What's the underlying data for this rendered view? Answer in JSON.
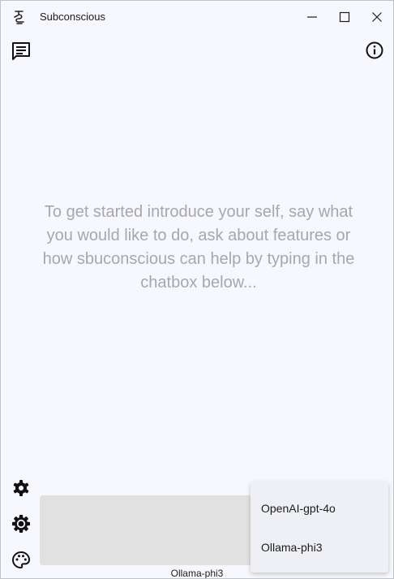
{
  "window": {
    "title": "Subconscious",
    "controls": [
      "minimize-icon",
      "maximize-icon",
      "close-icon"
    ]
  },
  "toolbar": {
    "left_icon": "chat-icon",
    "right_icon": "info-icon"
  },
  "main": {
    "intro_text": "To get started introduce your self, say what you would like to do, ask about features or how sbuconscious can help by typing in the chatbox below..."
  },
  "sidebar": {
    "icons": [
      "settings-gear-icon",
      "brightness-gear-icon",
      "palette-icon"
    ]
  },
  "chat": {
    "input_value": "",
    "selected_model": "Ollama-phi3"
  },
  "model_menu": {
    "items": [
      {
        "label": "OpenAI-gpt-4o"
      },
      {
        "label": "Ollama-phi3"
      }
    ]
  }
}
